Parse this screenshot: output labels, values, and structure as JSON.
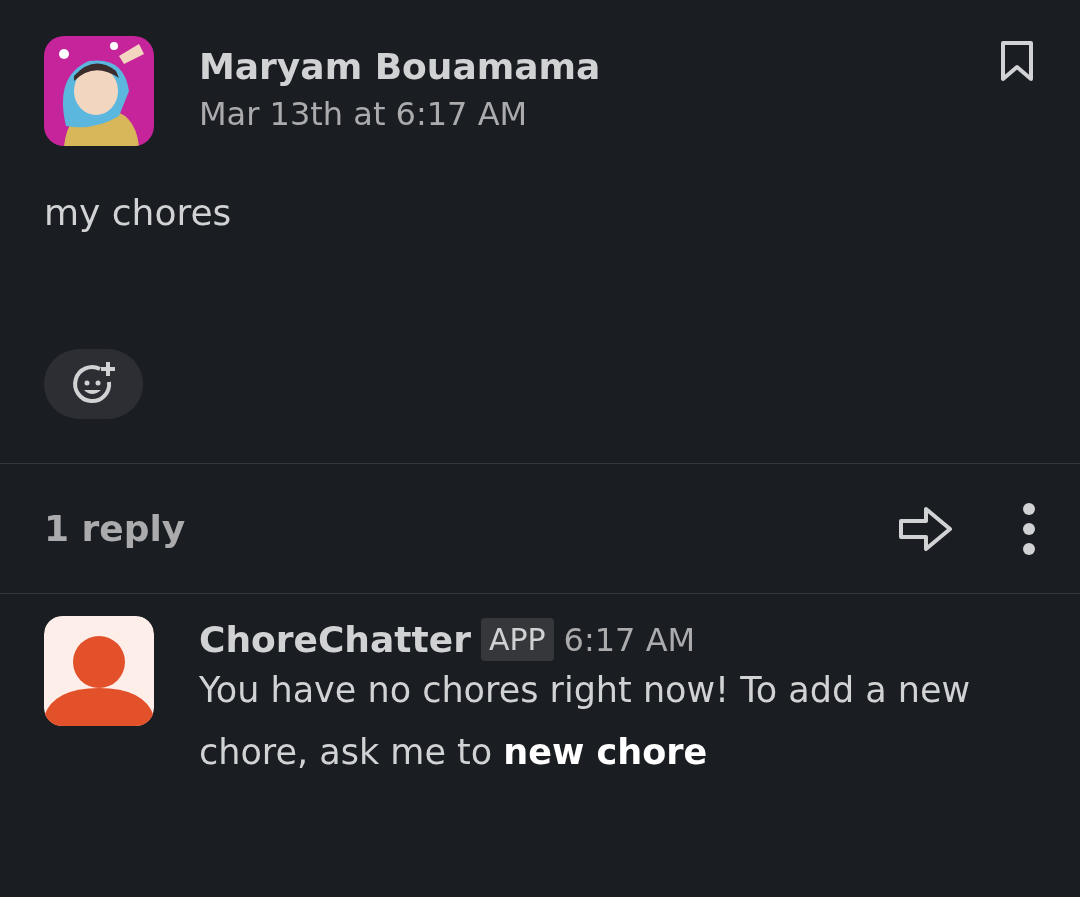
{
  "message": {
    "author": "Maryam Bouamama",
    "time": "Mar 13th at 6:17 AM",
    "text": "my chores",
    "bookmarked": false
  },
  "thread": {
    "reply_count": "1 reply"
  },
  "reply": {
    "author": "ChoreChatter",
    "badge": "APP",
    "time": "6:17 AM",
    "text": "You have no chores right now! To add a new chore, ask me to **new chore**"
  }
}
